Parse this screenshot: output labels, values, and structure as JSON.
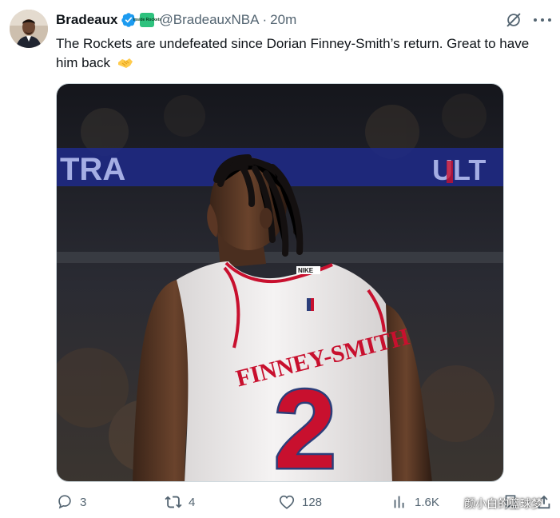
{
  "author": {
    "display_name": "Bradeaux",
    "handle": "@BradeauxNBA",
    "separator": "·",
    "time": "20m",
    "affiliate_badge_text": "Inside Rockets"
  },
  "tweet": {
    "text": "The Rockets are undefeated since Dorian Finney-Smith’s return. Great to have him back"
  },
  "media": {
    "jersey_name": "FINNEY-SMITH",
    "jersey_number": "2",
    "jersey_brand": "NIKE",
    "banner_left": "TRA",
    "banner_right": "ULT",
    "colors": {
      "jersey": "#f3f1f0",
      "trim": "#c8102e",
      "number_outline": "#2c3e7a"
    }
  },
  "actions": {
    "replies": "3",
    "reposts": "4",
    "likes": "128",
    "views": "1.6K"
  },
  "watermark": "颜小白的篮球梦",
  "icons": [
    "verified-badge-icon",
    "affiliate-badge-icon",
    "grok-icon",
    "more-icon",
    "handshake-emoji-icon",
    "reply-icon",
    "repost-icon",
    "like-icon",
    "views-icon",
    "bookmark-icon",
    "share-icon"
  ],
  "colors": {
    "text_primary": "#0f1419",
    "text_secondary": "#536471",
    "verified_blue": "#1d9bf0"
  }
}
